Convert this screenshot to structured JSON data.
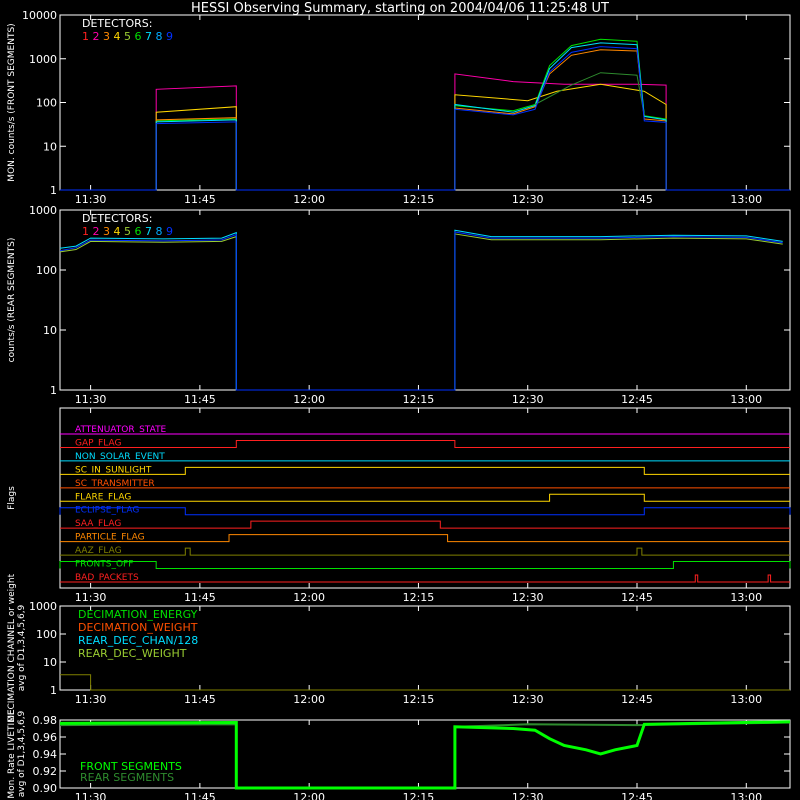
{
  "title": "HESSI Observing Summary, starting on 2004/04/06 11:25:48 UT",
  "colors": {
    "det": [
      "#ff2020",
      "#ff00aa",
      "#ff8800",
      "#ffd700",
      "#9acd32",
      "#00e000",
      "#00ddff",
      "#00aaff",
      "#0030ff"
    ],
    "fg": "#ffffff",
    "bg": "#000000"
  },
  "chart_data": [
    {
      "type": "line",
      "id": "front",
      "ylabel": "MON. counts/s (FRONT SEGMENTS)",
      "yscale": "log",
      "ylim": [
        1,
        10000
      ],
      "yticks": [
        "1",
        "10",
        "100",
        "1000",
        "10000"
      ],
      "xlim": [
        "11:25:48",
        "13:06:00"
      ],
      "xticks": [
        "11:30",
        "11:45",
        "12:00",
        "12:15",
        "12:30",
        "12:45",
        "13:00"
      ],
      "legend_title": "DETECTORS:",
      "legend_items": [
        "1",
        "2",
        "3",
        "4",
        "5",
        "6",
        "7",
        "8",
        "9"
      ],
      "series": [
        {
          "color": "#ff00aa",
          "points": [
            [
              "11:25:48",
              1
            ],
            [
              "11:39:00",
              1
            ],
            [
              "11:39:00",
              200
            ],
            [
              "11:50:00",
              240
            ],
            [
              "11:50:00",
              1
            ],
            [
              "12:20:00",
              1
            ],
            [
              "12:20:00",
              450
            ],
            [
              "12:28:00",
              300
            ],
            [
              "12:35:00",
              260
            ],
            [
              "12:45:00",
              260
            ],
            [
              "12:49:00",
              250
            ],
            [
              "12:49:00",
              1
            ],
            [
              "13:06:00",
              1
            ]
          ]
        },
        {
          "color": "#ffd700",
          "points": [
            [
              "11:25:48",
              1
            ],
            [
              "11:39:00",
              1
            ],
            [
              "11:39:00",
              60
            ],
            [
              "11:50:00",
              80
            ],
            [
              "11:50:00",
              1
            ],
            [
              "12:20:00",
              1
            ],
            [
              "12:20:00",
              150
            ],
            [
              "12:30:00",
              110
            ],
            [
              "12:34:00",
              180
            ],
            [
              "12:40:00",
              260
            ],
            [
              "12:46:00",
              180
            ],
            [
              "12:49:00",
              90
            ],
            [
              "12:49:00",
              1
            ],
            [
              "13:06:00",
              1
            ]
          ]
        },
        {
          "color": "#00e000",
          "points": [
            [
              "11:25:48",
              1
            ],
            [
              "11:39:00",
              1
            ],
            [
              "11:39:00",
              38
            ],
            [
              "11:50:00",
              42
            ],
            [
              "11:50:00",
              1
            ],
            [
              "12:20:00",
              1
            ],
            [
              "12:20:00",
              85
            ],
            [
              "12:28:00",
              65
            ],
            [
              "12:31:00",
              90
            ],
            [
              "12:33:00",
              700
            ],
            [
              "12:36:00",
              2000
            ],
            [
              "12:40:00",
              2800
            ],
            [
              "12:45:00",
              2500
            ],
            [
              "12:46:00",
              50
            ],
            [
              "12:49:00",
              42
            ],
            [
              "12:49:00",
              1
            ],
            [
              "13:06:00",
              1
            ]
          ]
        },
        {
          "color": "#ff8800",
          "points": [
            [
              "11:25:48",
              1
            ],
            [
              "11:39:00",
              1
            ],
            [
              "11:39:00",
              40
            ],
            [
              "11:50:00",
              45
            ],
            [
              "11:50:00",
              1
            ],
            [
              "12:20:00",
              1
            ],
            [
              "12:20:00",
              75
            ],
            [
              "12:28:00",
              55
            ],
            [
              "12:31:00",
              80
            ],
            [
              "12:33:00",
              450
            ],
            [
              "12:36:00",
              1200
            ],
            [
              "12:40:00",
              1600
            ],
            [
              "12:45:00",
              1500
            ],
            [
              "12:46:00",
              42
            ],
            [
              "12:49:00",
              38
            ],
            [
              "12:49:00",
              1
            ],
            [
              "13:06:00",
              1
            ]
          ]
        },
        {
          "color": "#00ddff",
          "points": [
            [
              "11:25:48",
              1
            ],
            [
              "11:39:00",
              1
            ],
            [
              "11:39:00",
              36
            ],
            [
              "11:50:00",
              40
            ],
            [
              "11:50:00",
              1
            ],
            [
              "12:20:00",
              1
            ],
            [
              "12:20:00",
              90
            ],
            [
              "12:28:00",
              60
            ],
            [
              "12:31:00",
              85
            ],
            [
              "12:33:00",
              600
            ],
            [
              "12:36:00",
              1800
            ],
            [
              "12:40:00",
              2300
            ],
            [
              "12:45:00",
              2100
            ],
            [
              "12:46:00",
              48
            ],
            [
              "12:49:00",
              40
            ],
            [
              "12:49:00",
              1
            ],
            [
              "13:06:00",
              1
            ]
          ]
        },
        {
          "color": "#2e8b2e",
          "points": [
            [
              "12:31:00",
              90
            ],
            [
              "12:36:00",
              250
            ],
            [
              "12:40:00",
              480
            ],
            [
              "12:45:00",
              420
            ],
            [
              "12:46:00",
              50
            ]
          ]
        },
        {
          "color": "#0030ff",
          "points": [
            [
              "11:25:48",
              1
            ],
            [
              "11:39:00",
              1
            ],
            [
              "11:39:00",
              33
            ],
            [
              "11:50:00",
              36
            ],
            [
              "11:50:00",
              1
            ],
            [
              "12:20:00",
              1
            ],
            [
              "12:20:00",
              70
            ],
            [
              "12:28:00",
              52
            ],
            [
              "12:31:00",
              70
            ],
            [
              "12:33:00",
              500
            ],
            [
              "12:36:00",
              1400
            ],
            [
              "12:40:00",
              1900
            ],
            [
              "12:45:00",
              1700
            ],
            [
              "12:46:00",
              38
            ],
            [
              "12:49:00",
              35
            ],
            [
              "12:49:00",
              1
            ],
            [
              "13:06:00",
              1
            ]
          ]
        }
      ]
    },
    {
      "type": "line",
      "id": "rear",
      "ylabel": "counts/s (REAR SEGMENTS)",
      "yscale": "log",
      "ylim": [
        1,
        1000
      ],
      "yticks": [
        "1",
        "10",
        "100",
        "1000"
      ],
      "xlim": [
        "11:25:48",
        "13:06:00"
      ],
      "xticks": [
        "11:30",
        "11:45",
        "12:00",
        "12:15",
        "12:30",
        "12:45",
        "13:00"
      ],
      "legend_title": "DETECTORS:",
      "legend_items": [
        "1",
        "2",
        "3",
        "4",
        "5",
        "6",
        "7",
        "8",
        "9"
      ],
      "series": [
        {
          "color": "#9acd32",
          "points": [
            [
              "11:25:48",
              200
            ],
            [
              "11:28:00",
              220
            ],
            [
              "11:30:00",
              300
            ],
            [
              "11:40:00",
              290
            ],
            [
              "11:48:00",
              300
            ],
            [
              "11:50:00",
              360
            ],
            [
              "11:50:00",
              1
            ],
            [
              "12:20:00",
              1
            ],
            [
              "12:20:00",
              400
            ],
            [
              "12:25:00",
              320
            ],
            [
              "12:40:00",
              320
            ],
            [
              "12:50:00",
              340
            ],
            [
              "13:00:00",
              330
            ],
            [
              "13:05:00",
              270
            ]
          ]
        },
        {
          "color": "#00ddff",
          "points": [
            [
              "11:25:48",
              230
            ],
            [
              "11:28:00",
              250
            ],
            [
              "11:30:00",
              340
            ],
            [
              "11:40:00",
              330
            ],
            [
              "11:48:00",
              340
            ],
            [
              "11:50:00",
              420
            ],
            [
              "11:50:00",
              1
            ],
            [
              "12:20:00",
              1
            ],
            [
              "12:20:00",
              460
            ],
            [
              "12:25:00",
              360
            ],
            [
              "12:40:00",
              360
            ],
            [
              "12:50:00",
              380
            ],
            [
              "13:00:00",
              370
            ],
            [
              "13:05:00",
              300
            ]
          ]
        },
        {
          "color": "#0030ff",
          "points": [
            [
              "11:25:48",
              210
            ],
            [
              "11:28:00",
              235
            ],
            [
              "11:30:00",
              315
            ],
            [
              "11:40:00",
              305
            ],
            [
              "11:48:00",
              318
            ],
            [
              "11:50:00",
              390
            ],
            [
              "11:50:00",
              1
            ],
            [
              "12:20:00",
              1
            ],
            [
              "12:20:00",
              430
            ],
            [
              "12:25:00",
              340
            ],
            [
              "12:40:00",
              340
            ],
            [
              "12:50:00",
              360
            ],
            [
              "13:00:00",
              350
            ],
            [
              "13:05:00",
              285
            ]
          ]
        }
      ]
    },
    {
      "type": "line",
      "id": "flags",
      "ylabel": "Flags",
      "xlim": [
        "11:25:48",
        "13:06:00"
      ],
      "xticks": [
        "11:30",
        "11:45",
        "12:00",
        "12:15",
        "12:30",
        "12:45",
        "13:00"
      ],
      "flags": [
        {
          "name": "ATTENUATOR_STATE",
          "color": "#ff00ff",
          "on": []
        },
        {
          "name": "GAP_FLAG",
          "color": "#ff2020",
          "on": [
            [
              "11:50:00",
              "12:20:00"
            ]
          ]
        },
        {
          "name": "NON_SOLAR_EVENT",
          "color": "#00ddff",
          "on": []
        },
        {
          "name": "SC_IN_SUNLIGHT",
          "color": "#ffd700",
          "on": [
            [
              "11:43:00",
              "12:46:00"
            ]
          ]
        },
        {
          "name": "SC_TRANSMITTER",
          "color": "#ff5000",
          "on": []
        },
        {
          "name": "FLARE_FLAG",
          "color": "#ffd700",
          "on": [
            [
              "12:33:00",
              "12:46:00"
            ]
          ]
        },
        {
          "name": "ECLIPSE_FLAG",
          "color": "#0030ff",
          "on": [
            [
              "11:25:48",
              "11:43:00"
            ],
            [
              "12:46:00",
              "13:06:00"
            ]
          ]
        },
        {
          "name": "SAA_FLAG",
          "color": "#ff2020",
          "on": [
            [
              "11:52:00",
              "12:18:00"
            ]
          ]
        },
        {
          "name": "PARTICLE_FLAG",
          "color": "#ff8800",
          "on": [
            [
              "11:49:00",
              "12:19:00"
            ]
          ]
        },
        {
          "name": "AAZ_FLAG",
          "color": "#808000",
          "on": [
            [
              "11:43:00",
              "11:43:40"
            ],
            [
              "12:45:00",
              "12:45:40"
            ]
          ]
        },
        {
          "name": "FRONTS_OFF",
          "color": "#00e000",
          "on": [
            [
              "11:25:48",
              "11:39:00"
            ],
            [
              "12:50:00",
              "13:06:00"
            ]
          ]
        },
        {
          "name": "BAD_PACKETS",
          "color": "#ff2020",
          "on": [
            [
              "12:53:00",
              "12:53:20"
            ],
            [
              "13:03:00",
              "13:03:20"
            ]
          ]
        }
      ]
    },
    {
      "type": "line",
      "id": "decimation",
      "ylabel": "DECIMATION CHANNEL or weight",
      "ylabel2": "avg of D1,3,4,5,6,9",
      "yscale": "log",
      "ylim": [
        1,
        1000
      ],
      "yticks": [
        "1",
        "10",
        "100",
        "1000"
      ],
      "xlim": [
        "11:25:48",
        "13:06:00"
      ],
      "xticks": [
        "11:30",
        "11:45",
        "12:00",
        "12:15",
        "12:30",
        "12:45",
        "13:00"
      ],
      "legend_items": [
        "DECIMATION_ENERGY",
        "DECIMATION_WEIGHT",
        "REAR_DEC_CHAN/128",
        "REAR_DEC_WEIGHT"
      ],
      "legend_colors": [
        "#00e000",
        "#ff5000",
        "#00ddff",
        "#9acd32"
      ],
      "series": [
        {
          "color": "#808000",
          "points": [
            [
              "11:25:48",
              3.5
            ],
            [
              "11:30:00",
              3.5
            ],
            [
              "11:30:00",
              0.9
            ],
            [
              "13:06:00",
              0.9
            ]
          ]
        }
      ]
    },
    {
      "type": "line",
      "id": "livetime",
      "ylabel": "Mon. Rate LIVETIME",
      "ylabel2": "avg of D1,3,4,5,6,9",
      "ylim": [
        0.9,
        0.98
      ],
      "yticks": [
        "0.90",
        "0.92",
        "0.94",
        "0.96",
        "0.98"
      ],
      "xlim": [
        "11:25:48",
        "13:06:00"
      ],
      "xticks": [
        "11:30",
        "11:45",
        "12:00",
        "12:15",
        "12:30",
        "12:45",
        "13:00"
      ],
      "legend_items": [
        "FRONT SEGMENTS",
        "REAR SEGMENTS"
      ],
      "legend_colors": [
        "#00ff00",
        "#2e8b2e"
      ],
      "series": [
        {
          "color": "#2e8b2e",
          "width": 2,
          "points": [
            [
              "11:25:48",
              0.974
            ],
            [
              "11:50:00",
              0.975
            ],
            [
              "11:50:00",
              0.9
            ],
            [
              "12:20:00",
              0.9
            ],
            [
              "12:20:00",
              0.972
            ],
            [
              "12:30:00",
              0.975
            ],
            [
              "12:45:00",
              0.974
            ],
            [
              "13:06:00",
              0.977
            ]
          ]
        },
        {
          "color": "#00ff00",
          "width": 3,
          "points": [
            [
              "11:25:48",
              0.976
            ],
            [
              "11:50:00",
              0.977
            ],
            [
              "11:50:00",
              0.9
            ],
            [
              "12:20:00",
              0.9
            ],
            [
              "12:20:00",
              0.972
            ],
            [
              "12:28:00",
              0.97
            ],
            [
              "12:31:00",
              0.968
            ],
            [
              "12:33:00",
              0.958
            ],
            [
              "12:35:00",
              0.95
            ],
            [
              "12:38:00",
              0.945
            ],
            [
              "12:40:00",
              0.94
            ],
            [
              "12:42:00",
              0.945
            ],
            [
              "12:45:00",
              0.95
            ],
            [
              "12:46:00",
              0.975
            ],
            [
              "13:06:00",
              0.978
            ]
          ]
        }
      ]
    }
  ]
}
